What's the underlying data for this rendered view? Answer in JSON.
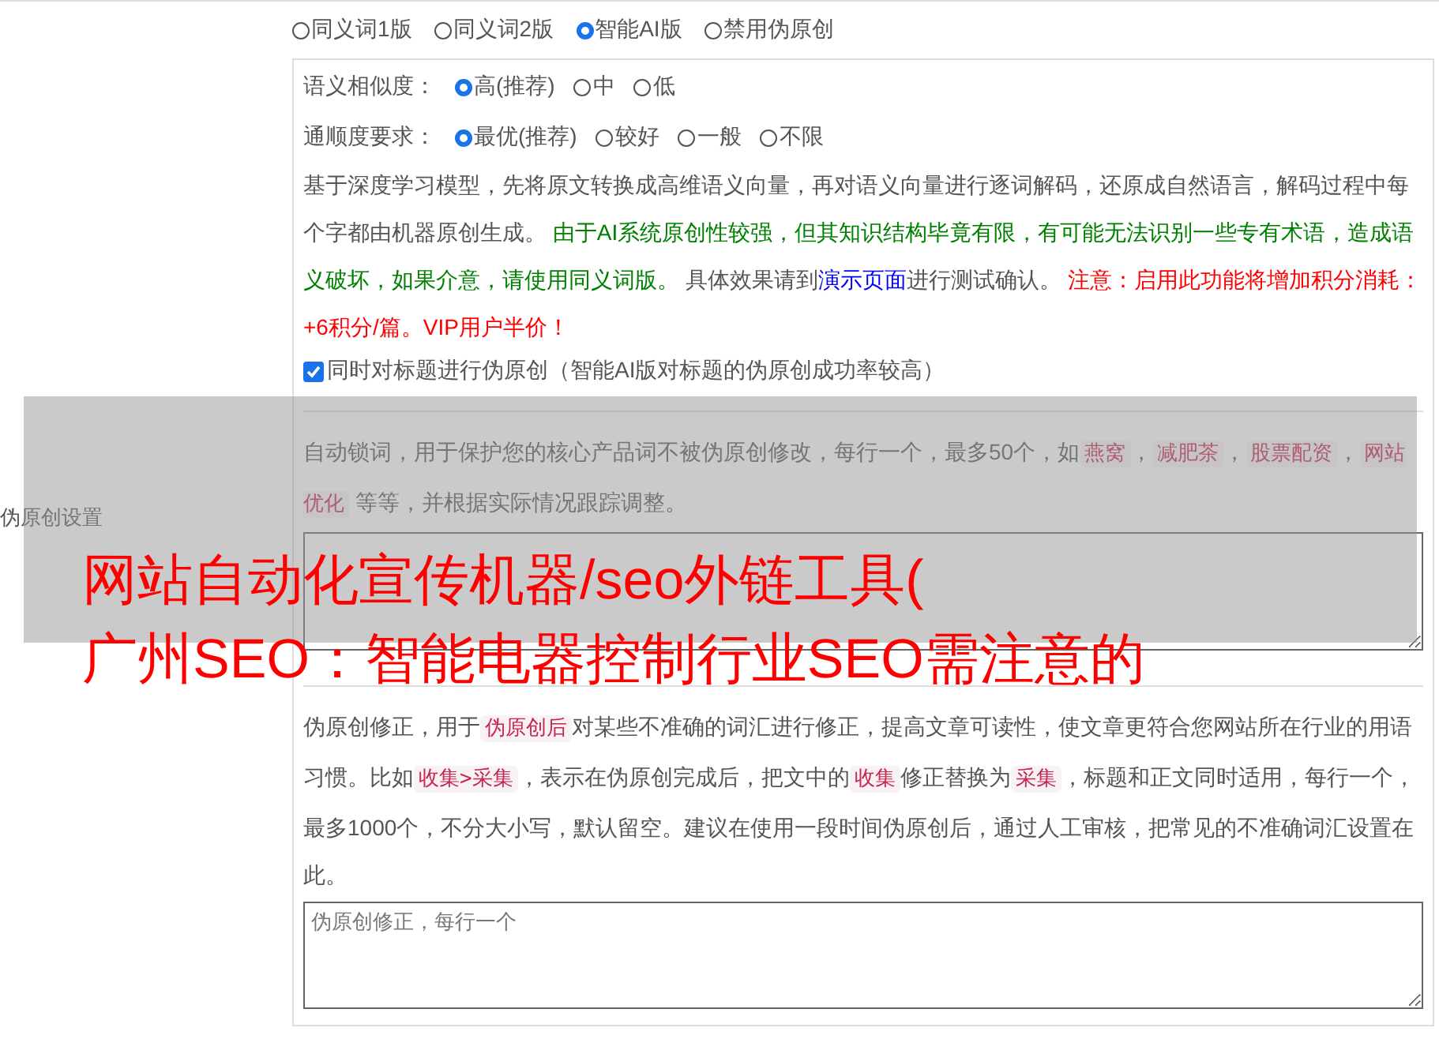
{
  "section_label": "伪原创设置",
  "modes": [
    {
      "label": "同义词1版",
      "selected": false
    },
    {
      "label": "同义词2版",
      "selected": false
    },
    {
      "label": "智能AI版",
      "selected": true
    },
    {
      "label": "禁用伪原创",
      "selected": false
    }
  ],
  "settings": [
    {
      "label": "语义相似度：",
      "options": [
        {
          "label": "高(推荐)",
          "selected": true
        },
        {
          "label": "中",
          "selected": false
        },
        {
          "label": "低",
          "selected": false
        }
      ]
    },
    {
      "label": "通顺度要求：",
      "options": [
        {
          "label": "最优(推荐)",
          "selected": true
        },
        {
          "label": "较好",
          "selected": false
        },
        {
          "label": "一般",
          "selected": false
        },
        {
          "label": "不限",
          "selected": false
        }
      ]
    }
  ],
  "description": [
    {
      "kind": "plain",
      "text": "基于深度学习模型，先将原文转换成高维语义向量，再对语义向量进行逐词解码，还原成自然语言，解码过程中每个字都由机器原创生成。 "
    },
    {
      "kind": "green",
      "text": "由于AI系统原创性较强，但其知识结构毕竟有限，有可能无法识别一些专有术语，造成语义破坏，如果介意，请使用同义词版。"
    },
    {
      "kind": "plain",
      "text": " 具体效果请到"
    },
    {
      "kind": "link",
      "text": "演示页面"
    },
    {
      "kind": "plain",
      "text": "进行测试确认。 "
    },
    {
      "kind": "red",
      "text": "注意：启用此功能将增加积分消耗：+6积分/篇。VIP用户半价！"
    }
  ],
  "title_option": {
    "label": "同时对标题进行伪原创（智能AI版对标题的伪原创成功率较高）",
    "checked": true
  },
  "lock_words": {
    "description": [
      {
        "kind": "plain",
        "text": "自动锁词，用于保护您的核心产品词不被伪原创修改，每行一个，最多50个，如"
      },
      {
        "kind": "code",
        "text": "燕窝"
      },
      {
        "kind": "plain",
        "text": "，"
      },
      {
        "kind": "code",
        "text": "减肥茶"
      },
      {
        "kind": "plain",
        "text": "，"
      },
      {
        "kind": "code",
        "text": "股票配资"
      },
      {
        "kind": "plain",
        "text": "，"
      },
      {
        "kind": "code",
        "text": "网站优化"
      },
      {
        "kind": "plain",
        "text": " 等等，并根据实际情况跟踪调整。"
      }
    ]
  },
  "corrections": {
    "description": [
      {
        "kind": "plain",
        "text": "伪原创修正，用于"
      },
      {
        "kind": "code",
        "text": "伪原创后"
      },
      {
        "kind": "plain",
        "text": "对某些不准确的词汇进行修正，提高文章可读性，使文章更符合您网站所在行业的用语习惯。比如"
      },
      {
        "kind": "code",
        "text": "收集>采集"
      },
      {
        "kind": "plain",
        "text": "，表示在伪原创完成后，把文中的"
      },
      {
        "kind": "code",
        "text": "收集"
      },
      {
        "kind": "plain",
        "text": "修正替换为"
      },
      {
        "kind": "code",
        "text": "采集"
      },
      {
        "kind": "plain",
        "text": "，标题和正文同时适用，每行一个，最多1000个，不分大小写，默认留空。建议在使用一段时间伪原创后，通过人工审核，把常见的不准确词汇设置在此。"
      }
    ],
    "placeholder": "伪原创修正，每行一个"
  },
  "overlay": {
    "lines": [
      "网站自动化宣传机器/seo外链工具(",
      "广州SEO：智能电器控制行业SEO需注意的"
    ]
  }
}
